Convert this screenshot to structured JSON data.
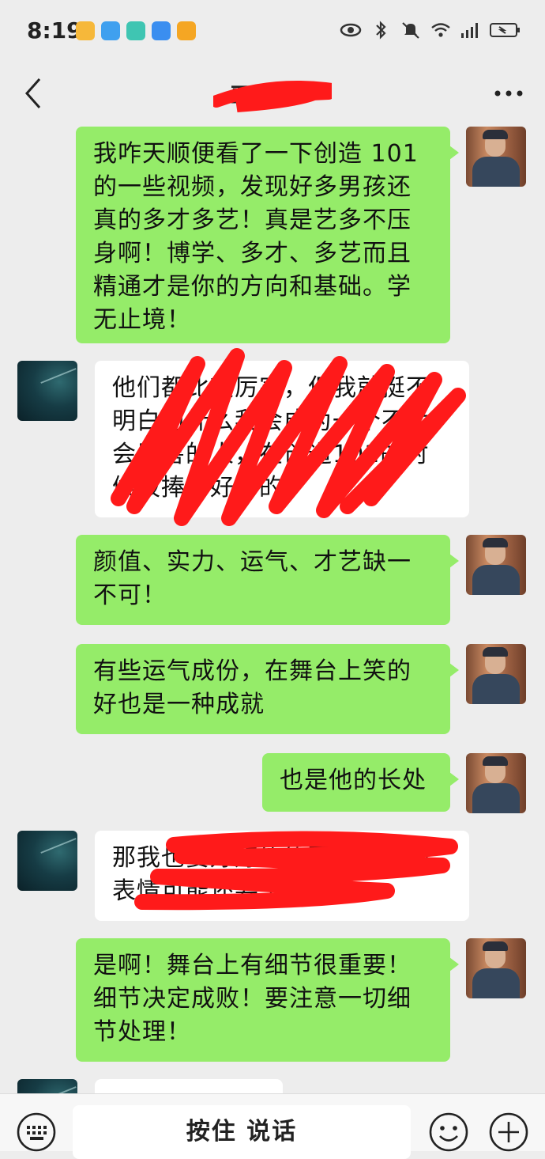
{
  "status_bar": {
    "time": "8:19",
    "app_icons": [
      "weibo-icon",
      "app-blue-icon",
      "app-teal-icon",
      "cloud-icon",
      "app-orange-icon"
    ],
    "right_icons": [
      "eye-icon",
      "bluetooth-icon",
      "mute-icon",
      "wifi-icon",
      "signal-icon",
      "battery-icon"
    ]
  },
  "nav": {
    "title": "覃",
    "back_icon": "back-chevron-icon",
    "more_icon": "more-icon"
  },
  "messages": [
    {
      "side": "sent",
      "text": "我咋天顺便看了一下创造 101 的一些视频，发现好多男孩还真的多才多艺！真是艺多不压身啊！博学、多才、多艺而且精通才是你的方向和基础。学无止境！"
    },
    {
      "side": "received",
      "text": "他们都比较厉害，但我就挺不明白为什么我会成为一个不太会厉害的人，在创造101的时候被捧得好多的"
    },
    {
      "side": "sent",
      "text": "颜值、实力、运气、才艺缺一不可！"
    },
    {
      "side": "sent",
      "text": "有些运气成份，在舞台上笑的好也是一种成就"
    },
    {
      "side": "sent",
      "text": "也是他的长处"
    },
    {
      "side": "received",
      "text": "那我也要好好练练面部，我的表情可能还要丰富一些"
    },
    {
      "side": "sent",
      "text": "是啊！舞台上有细节很重要！细节决定成败！要注意一切细节处理！"
    },
    {
      "side": "received",
      "text": ""
    }
  ],
  "input_bar": {
    "hold_to_talk": "按住 说话",
    "left_icon": "keyboard-icon",
    "emoji_icon": "emoji-icon",
    "plus_icon": "plus-icon"
  },
  "colors": {
    "sent_bubble": "#95ec69",
    "recv_bubble": "#ffffff",
    "background": "#ededed",
    "redaction": "#ff1a1a"
  }
}
